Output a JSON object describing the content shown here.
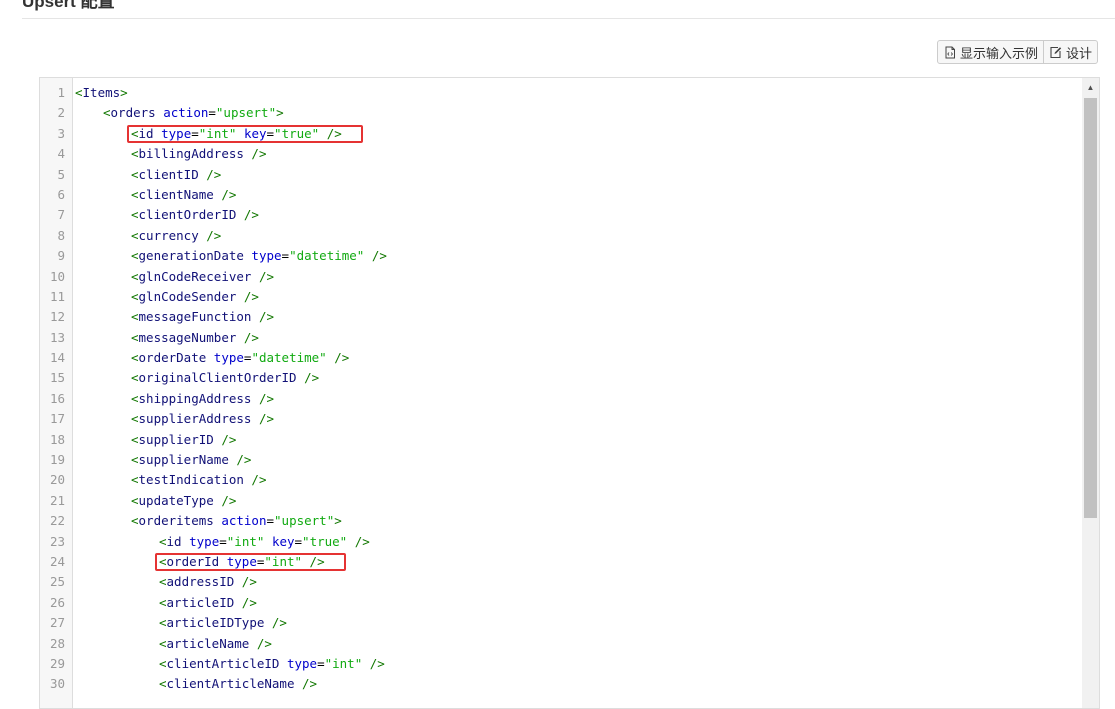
{
  "page": {
    "title": "Upsert 配置"
  },
  "toolbar": {
    "show_example_label": "显示输入示例",
    "show_example_icon": "file-code-icon",
    "design_label": "设计",
    "design_icon": "edit-icon"
  },
  "editor": {
    "lines": [
      {
        "num": "1",
        "indent": 0,
        "tag": "Items",
        "attrs": [],
        "close": ">",
        "highlight": false
      },
      {
        "num": "2",
        "indent": 1,
        "tag": "orders",
        "attrs": [
          {
            "name": "action",
            "value": "\"upsert\""
          }
        ],
        "close": ">",
        "highlight": false
      },
      {
        "num": "3",
        "indent": 2,
        "tag": "id",
        "attrs": [
          {
            "name": "type",
            "value": "\"int\""
          },
          {
            "name": "key",
            "value": "\"true\""
          }
        ],
        "close": " />",
        "highlight": true
      },
      {
        "num": "4",
        "indent": 2,
        "tag": "billingAddress",
        "attrs": [],
        "close": " />",
        "highlight": false
      },
      {
        "num": "5",
        "indent": 2,
        "tag": "clientID",
        "attrs": [],
        "close": " />",
        "highlight": false
      },
      {
        "num": "6",
        "indent": 2,
        "tag": "clientName",
        "attrs": [],
        "close": " />",
        "highlight": false
      },
      {
        "num": "7",
        "indent": 2,
        "tag": "clientOrderID",
        "attrs": [],
        "close": " />",
        "highlight": false
      },
      {
        "num": "8",
        "indent": 2,
        "tag": "currency",
        "attrs": [],
        "close": " />",
        "highlight": false
      },
      {
        "num": "9",
        "indent": 2,
        "tag": "generationDate",
        "attrs": [
          {
            "name": "type",
            "value": "\"datetime\""
          }
        ],
        "close": " />",
        "highlight": false
      },
      {
        "num": "10",
        "indent": 2,
        "tag": "glnCodeReceiver",
        "attrs": [],
        "close": " />",
        "highlight": false
      },
      {
        "num": "11",
        "indent": 2,
        "tag": "glnCodeSender",
        "attrs": [],
        "close": " />",
        "highlight": false
      },
      {
        "num": "12",
        "indent": 2,
        "tag": "messageFunction",
        "attrs": [],
        "close": " />",
        "highlight": false
      },
      {
        "num": "13",
        "indent": 2,
        "tag": "messageNumber",
        "attrs": [],
        "close": " />",
        "highlight": false
      },
      {
        "num": "14",
        "indent": 2,
        "tag": "orderDate",
        "attrs": [
          {
            "name": "type",
            "value": "\"datetime\""
          }
        ],
        "close": " />",
        "highlight": false
      },
      {
        "num": "15",
        "indent": 2,
        "tag": "originalClientOrderID",
        "attrs": [],
        "close": " />",
        "highlight": false
      },
      {
        "num": "16",
        "indent": 2,
        "tag": "shippingAddress",
        "attrs": [],
        "close": " />",
        "highlight": false
      },
      {
        "num": "17",
        "indent": 2,
        "tag": "supplierAddress",
        "attrs": [],
        "close": " />",
        "highlight": false
      },
      {
        "num": "18",
        "indent": 2,
        "tag": "supplierID",
        "attrs": [],
        "close": " />",
        "highlight": false
      },
      {
        "num": "19",
        "indent": 2,
        "tag": "supplierName",
        "attrs": [],
        "close": " />",
        "highlight": false
      },
      {
        "num": "20",
        "indent": 2,
        "tag": "testIndication",
        "attrs": [],
        "close": " />",
        "highlight": false
      },
      {
        "num": "21",
        "indent": 2,
        "tag": "updateType",
        "attrs": [],
        "close": " />",
        "highlight": false
      },
      {
        "num": "22",
        "indent": 2,
        "tag": "orderitems",
        "attrs": [
          {
            "name": "action",
            "value": "\"upsert\""
          }
        ],
        "close": ">",
        "highlight": false
      },
      {
        "num": "23",
        "indent": 3,
        "tag": "id",
        "attrs": [
          {
            "name": "type",
            "value": "\"int\""
          },
          {
            "name": "key",
            "value": "\"true\""
          }
        ],
        "close": " />",
        "highlight": false
      },
      {
        "num": "24",
        "indent": 3,
        "tag": "orderId",
        "attrs": [
          {
            "name": "type",
            "value": "\"int\""
          }
        ],
        "close": " />",
        "highlight": true
      },
      {
        "num": "25",
        "indent": 3,
        "tag": "addressID",
        "attrs": [],
        "close": " />",
        "highlight": false
      },
      {
        "num": "26",
        "indent": 3,
        "tag": "articleID",
        "attrs": [],
        "close": " />",
        "highlight": false
      },
      {
        "num": "27",
        "indent": 3,
        "tag": "articleIDType",
        "attrs": [],
        "close": " />",
        "highlight": false
      },
      {
        "num": "28",
        "indent": 3,
        "tag": "articleName",
        "attrs": [],
        "close": " />",
        "highlight": false
      },
      {
        "num": "29",
        "indent": 3,
        "tag": "clientArticleID",
        "attrs": [
          {
            "name": "type",
            "value": "\"int\""
          }
        ],
        "close": " />",
        "highlight": false
      },
      {
        "num": "30",
        "indent": 3,
        "tag": "clientArticleName",
        "attrs": [],
        "close": " />",
        "highlight": false
      }
    ]
  },
  "colors": {
    "highlight_border": "#e53333"
  }
}
